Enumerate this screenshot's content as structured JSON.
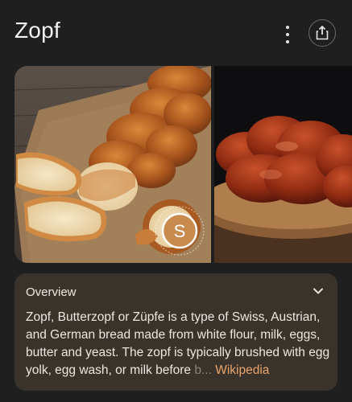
{
  "page": {
    "title": "Zopf"
  },
  "header": {
    "more_icon": "more-vert-icon",
    "share_icon": "share-icon"
  },
  "gallery": {
    "images": [
      {
        "alt": "Braided Zopf loaf sliced on parchment",
        "badge_letter": "S",
        "badge_ring_text": "SWISSMILK.CH • SWISSNESS SINCE"
      },
      {
        "alt": "Braided Zopf loaf on wooden board"
      }
    ]
  },
  "overview": {
    "heading": "Overview",
    "text_main": "Zopf, Butterzopf or Züpfe is a type of Swiss, Austrian, and German bread made from white flour, milk, eggs, butter and yeast. The zopf is typically brushed with egg yolk, egg wash, or milk before ",
    "text_faded": "b...",
    "source": "Wikipedia",
    "expand_icon": "chevron-down-icon"
  },
  "colors": {
    "background": "#1f1f1f",
    "card": "#3a332c",
    "link": "#e9a46b"
  }
}
